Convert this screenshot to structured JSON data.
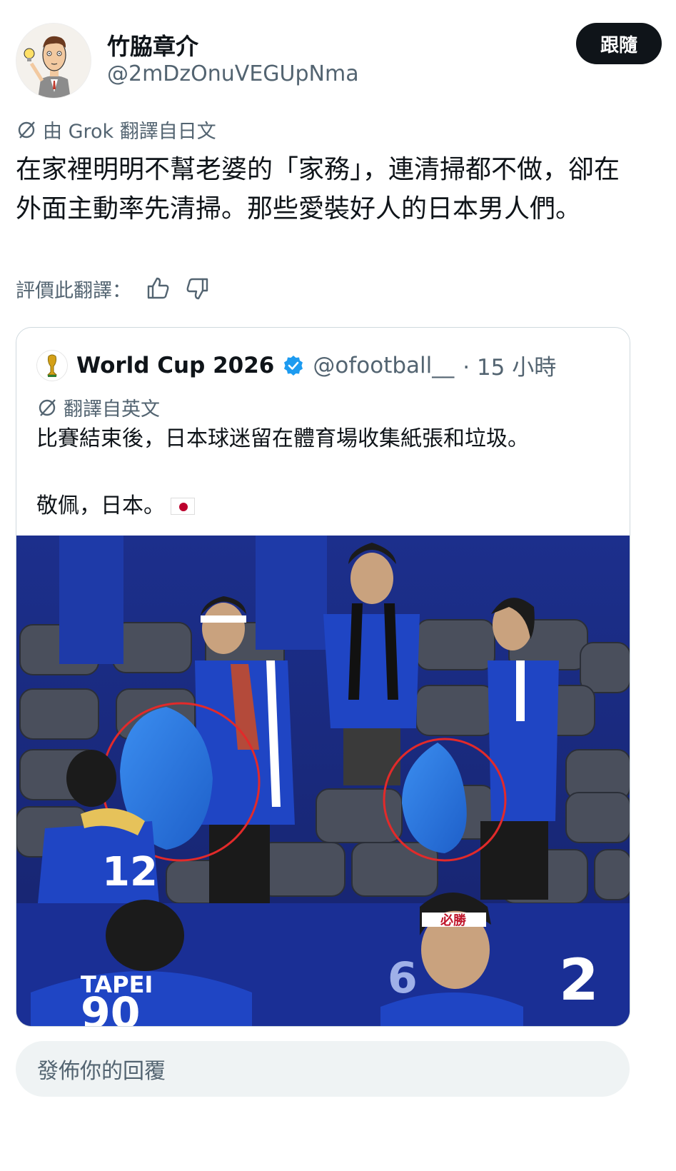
{
  "author": {
    "display_name": "竹脇章介",
    "handle": "@2mDzOnuVEGUpNma"
  },
  "follow_button": "跟隨",
  "translation_note": "由 Grok 翻譯自日文",
  "tweet_text": "在家裡明明不幫老婆的「家務」，連清掃都不做，卻在外面主動率先清掃。那些愛裝好人的日本男人們。",
  "rate": {
    "label": "評價此翻譯：",
    "like_icon": "thumbs-up-icon",
    "dislike_icon": "thumbs-down-icon"
  },
  "quote": {
    "name": "World Cup 2026",
    "handle": "@ofootball__",
    "time": "· 15 小時",
    "translation_note": "翻譯自英文",
    "text_line1": "比賽結束後，日本球迷留在體育場收集紙張和垃圾。",
    "text_line2": "敬佩，日本。",
    "jersey_labels": [
      "12",
      "TAPEI",
      "90",
      "6",
      "2"
    ],
    "headband_text": "必勝"
  },
  "reply_placeholder": "發佈你的回覆",
  "colors": {
    "text_primary": "#0f1419",
    "text_secondary": "#536471",
    "verified_blue": "#1d9bf0",
    "border": "#cfd9de",
    "reply_bg": "#eff3f4"
  }
}
